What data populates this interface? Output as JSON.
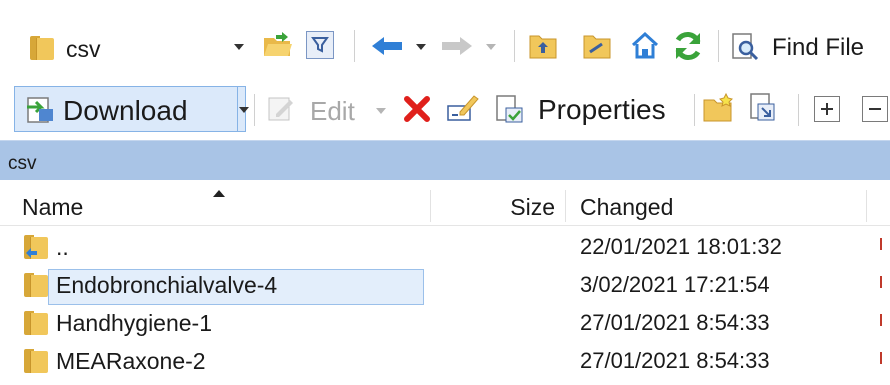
{
  "toolbar1": {
    "location_value": "csv",
    "find_label": "Find File"
  },
  "toolbar2": {
    "download_label": "Download",
    "edit_label": "Edit",
    "properties_label": "Properties"
  },
  "path": {
    "current": "csv"
  },
  "columns": {
    "name": "Name",
    "size": "Size",
    "changed": "Changed"
  },
  "files": [
    {
      "name": "..",
      "size": "",
      "changed": "22/01/2021 18:01:32"
    },
    {
      "name": "Endobronchialvalve-4",
      "size": "",
      "changed": "3/02/2021 17:21:54",
      "selected": true
    },
    {
      "name": "Handhygiene-1",
      "size": "",
      "changed": "27/01/2021 8:54:33"
    },
    {
      "name": "MEARaxone-2",
      "size": "",
      "changed": "27/01/2021 8:54:33"
    }
  ],
  "colors": {
    "path_bar": "#a9c4e6",
    "selection": "#e3eefb",
    "selection_border": "#9bc0ea",
    "folder": "#f1c75b",
    "delete_red": "#e0201b",
    "nav_blue": "#2f7fd6",
    "refresh_green": "#3aa33a"
  },
  "icons": [
    "folder-icon",
    "open-folder-icon",
    "filter-icon",
    "back-arrow-icon",
    "forward-arrow-icon",
    "parent-folder-icon",
    "root-folder-icon",
    "home-icon",
    "refresh-icon",
    "find-icon",
    "download-icon",
    "edit-icon",
    "delete-icon",
    "rename-icon",
    "properties-icon",
    "new-folder-icon",
    "copy-icon",
    "expand-icon",
    "collapse-icon",
    "sort-ascending-icon"
  ]
}
